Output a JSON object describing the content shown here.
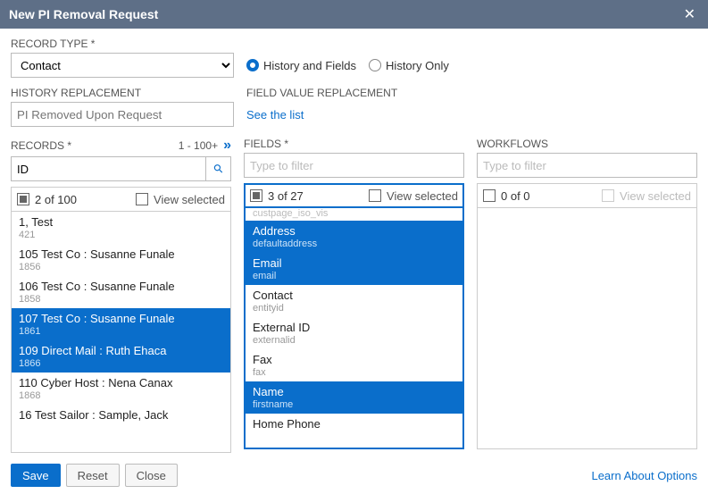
{
  "title": "New PI Removal Request",
  "close_glyph": "✕",
  "labels": {
    "record_type": "RECORD TYPE *",
    "history_replacement": "HISTORY REPLACEMENT",
    "fvr": "FIELD VALUE REPLACEMENT",
    "see_list": "See the list",
    "records": "RECORDS *",
    "records_range": "1 - 100+",
    "fields": "FIELDS *",
    "workflows": "WORKFLOWS"
  },
  "record_type_value": "Contact",
  "radios": {
    "hf": "History and Fields",
    "ho": "History Only",
    "selected": "hf"
  },
  "hrepl_placeholder": "PI Removed Upon Request",
  "filter": {
    "records_value": "ID",
    "fields_placeholder": "Type to filter",
    "wf_placeholder": "Type to filter"
  },
  "counts": {
    "records": "2 of 100",
    "fields": "3 of 27",
    "wf": "0 of 0",
    "view_selected": "View selected"
  },
  "records_items": [
    {
      "t1": "1, Test",
      "t2": "421",
      "sel": false
    },
    {
      "t1": "105 Test Co : Susanne Funale",
      "t2": "1856",
      "sel": false
    },
    {
      "t1": "106 Test Co : Susanne Funale",
      "t2": "1858",
      "sel": false
    },
    {
      "t1": "107 Test Co : Susanne Funale",
      "t2": "1861",
      "sel": true
    },
    {
      "t1": "109 Direct Mail : Ruth Ehaca",
      "t2": "1866",
      "sel": true
    },
    {
      "t1": "110 Cyber Host : Nena Canax",
      "t2": "1868",
      "sel": false
    },
    {
      "t1": "16 Test Sailor : Sample, Jack",
      "t2": "",
      "sel": false
    }
  ],
  "fields_cut": "custpage_iso_vis",
  "fields_items": [
    {
      "t1": "Address",
      "t2": "defaultaddress",
      "sel": true
    },
    {
      "t1": "Email",
      "t2": "email",
      "sel": true
    },
    {
      "t1": "Contact",
      "t2": "entityid",
      "sel": false
    },
    {
      "t1": "External ID",
      "t2": "externalid",
      "sel": false
    },
    {
      "t1": "Fax",
      "t2": "fax",
      "sel": false
    },
    {
      "t1": "Name",
      "t2": "firstname",
      "sel": true
    },
    {
      "t1": "Home Phone",
      "t2": "",
      "sel": false
    }
  ],
  "buttons": {
    "save": "Save",
    "reset": "Reset",
    "close": "Close"
  },
  "learn": "Learn About Options",
  "glyphs": {
    "dblarrow": "»",
    "search": "⚲"
  }
}
